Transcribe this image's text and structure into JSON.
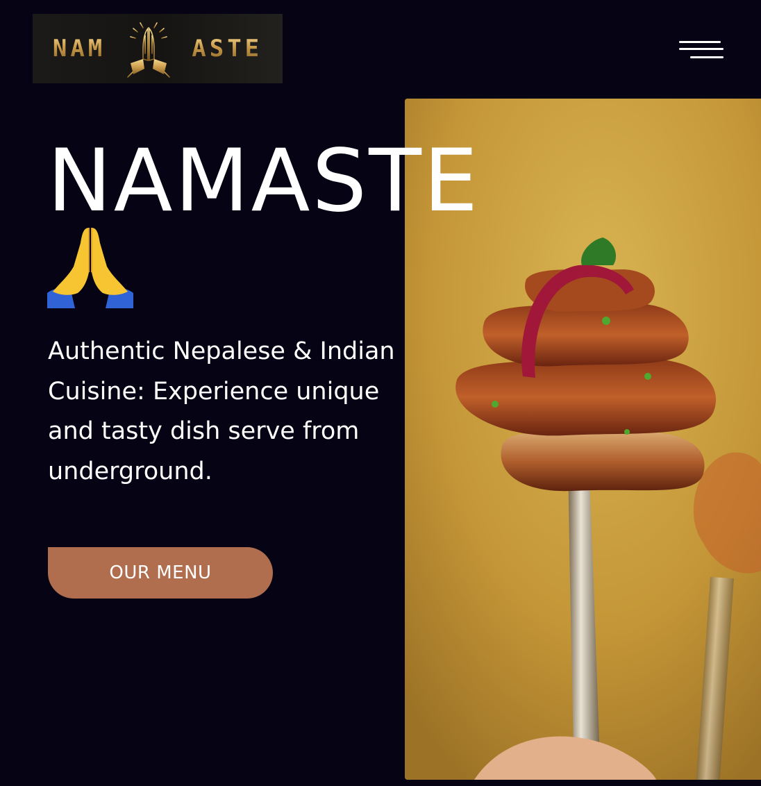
{
  "header": {
    "logo": {
      "left_text": "NAM",
      "right_text": "ASTE",
      "icon": "praying-hands-icon"
    },
    "menu_toggle": {
      "icon": "hamburger-menu-icon"
    }
  },
  "hero": {
    "title": "NAMASTE",
    "emoji": "praying-hands-emoji",
    "tagline": "Authentic Nepalese & Indian Cuisine: Experience unique and tasty dish serve from underground.",
    "cta_label": "OUR MENU",
    "photo": "grilled-skewer-on-fork-photo"
  },
  "colors": {
    "background": "#050314",
    "cta": "#b06e4f",
    "photo_bg": "#c69a3d",
    "logo_gold": "#d8b064"
  }
}
